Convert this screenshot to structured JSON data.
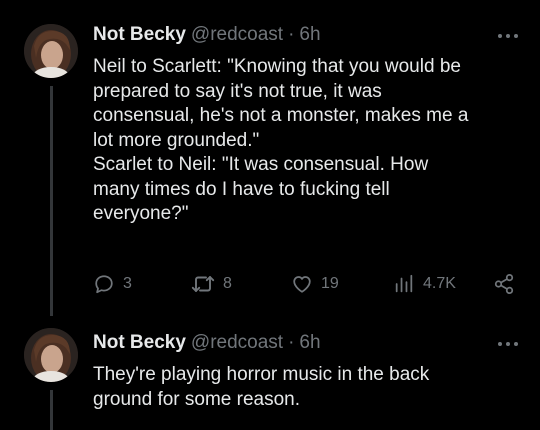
{
  "tweets": [
    {
      "author_name": "Not Becky",
      "handle": "@redcoast",
      "separator": "·",
      "time": "6h",
      "lines": [
        "Neil to Scarlett: \"Knowing that you would be",
        "prepared to say it's not true, it was",
        "consensual, he's not a monster, makes me a",
        "lot more grounded.\"",
        "Scarlet to Neil: \"It was consensual. How",
        "many times do I have to fucking tell",
        "everyone?\""
      ],
      "actions": {
        "replies": "3",
        "retweets": "8",
        "likes": "19",
        "views": "4.7K"
      }
    },
    {
      "author_name": "Not Becky",
      "handle": "@redcoast",
      "separator": "·",
      "time": "6h",
      "lines": [
        "They're playing horror music in the back",
        "ground for some reason."
      ]
    }
  ],
  "icons": {
    "reply": "reply-icon",
    "retweet": "retweet-icon",
    "like": "heart-icon",
    "views": "views-icon",
    "share": "share-icon",
    "more": "more-icon"
  },
  "colors": {
    "background": "#000000",
    "text": "#e7e9ea",
    "muted": "#71767b",
    "thread_line": "#333639"
  }
}
